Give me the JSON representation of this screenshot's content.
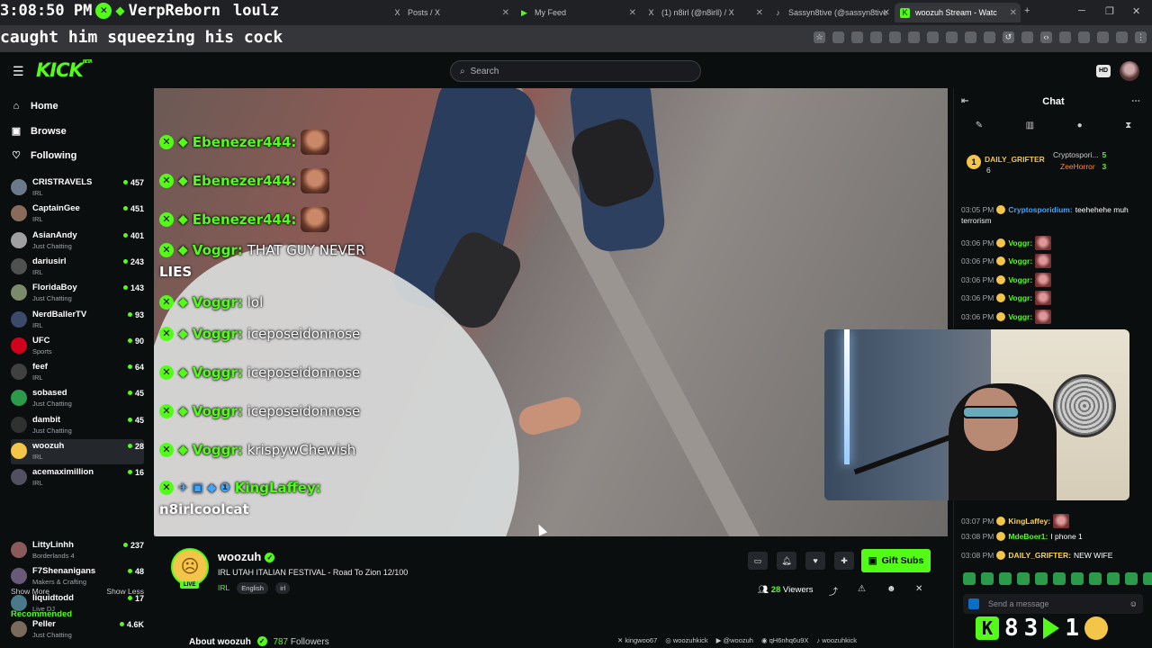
{
  "overlay_top": {
    "clock": "3:08:50 PM",
    "ticker_name": "VerpReborn",
    "ticker_extra": "loulz",
    "caption": "caught him squeezing his cock"
  },
  "browser": {
    "tabs": [
      {
        "label": "Posts / X",
        "icon": "X"
      },
      {
        "label": "My Feed",
        "icon": "▶"
      },
      {
        "label": "(1) n8irl (@n8irll) / X",
        "icon": "X"
      },
      {
        "label": "Sassyn8tive (@sassyn8tive",
        "icon": "♪"
      },
      {
        "label": "woozuh Stream - Watc",
        "icon": "K"
      }
    ],
    "new_tab": "+",
    "window_controls": [
      "─",
      "❐",
      "✕"
    ]
  },
  "header": {
    "logo": "KICK",
    "logo_sup": "BETA",
    "search_placeholder": "Search"
  },
  "sidebar": {
    "nav": [
      {
        "label": "Home",
        "icon": "⌂"
      },
      {
        "label": "Browse",
        "icon": "▣"
      },
      {
        "label": "Following",
        "icon": "♡"
      }
    ],
    "following": [
      {
        "name": "CRISTRAVELS",
        "category": "IRL",
        "viewers": "457",
        "color": "#6a7a8a"
      },
      {
        "name": "CaptainGee",
        "category": "IRL",
        "viewers": "451",
        "color": "#8a6a5a"
      },
      {
        "name": "AsianAndy",
        "category": "Just Chatting",
        "viewers": "401",
        "color": "#a0a0a0"
      },
      {
        "name": "dariusirl",
        "category": "IRL",
        "viewers": "243",
        "color": "#505050"
      },
      {
        "name": "FloridaBoy",
        "category": "Just Chatting",
        "viewers": "143",
        "color": "#7a8a6a"
      },
      {
        "name": "NerdBallerTV",
        "category": "IRL",
        "viewers": "93",
        "color": "#3a4a6a"
      },
      {
        "name": "UFC",
        "category": "Sports",
        "viewers": "90",
        "color": "#d0021b"
      },
      {
        "name": "feef",
        "category": "IRL",
        "viewers": "64",
        "color": "#404040"
      },
      {
        "name": "sobased",
        "category": "Just Chatting",
        "viewers": "45",
        "color": "#2b9a4a"
      },
      {
        "name": "dambit",
        "category": "Just Chatting",
        "viewers": "45",
        "color": "#303030"
      },
      {
        "name": "woozuh",
        "category": "IRL",
        "viewers": "28",
        "color": "#f3c64a"
      },
      {
        "name": "acemaximillion",
        "category": "IRL",
        "viewers": "16",
        "color": "#505060"
      }
    ],
    "show_more": "Show More",
    "show_less": "Show Less",
    "recommended_title": "Recommended",
    "recommended": [
      {
        "name": "LittyLinhh",
        "category": "Borderlands 4",
        "viewers": "237",
        "color": "#8a5a5a"
      },
      {
        "name": "F7Shenanigans",
        "category": "Makers & Crafting",
        "viewers": "48",
        "color": "#6a5a7a"
      },
      {
        "name": "liquidtodd",
        "category": "Live DJ",
        "viewers": "17",
        "color": "#4a7a8a"
      },
      {
        "name": "Peller",
        "category": "Just Chatting",
        "viewers": "4.6K",
        "color": "#7a6a5a"
      }
    ]
  },
  "video_overlay_chat": [
    {
      "user": "Ebenezer444:",
      "msg": "",
      "emote": true
    },
    {
      "user": "Ebenezer444:",
      "msg": "",
      "emote": true
    },
    {
      "user": "Ebenezer444:",
      "msg": "",
      "emote": true
    },
    {
      "user": "Voggr:",
      "msg": "THAT GUY NEVER",
      "cont": "LIES"
    },
    {
      "user": "Voggr:",
      "msg": "lol"
    },
    {
      "user": "Voggr:",
      "msg": "iceposeidonnose"
    },
    {
      "user": "Voggr:",
      "msg": "iceposeidonnose"
    },
    {
      "user": "Voggr:",
      "msg": "iceposeidonnose"
    },
    {
      "user": "Voggr:",
      "msg": "krispywChewish"
    },
    {
      "user": "KingLaffey:",
      "msg": "",
      "cont": "n8irlcoolcat"
    }
  ],
  "stream": {
    "name": "woozuh",
    "title": "IRL UTAH ITALIAN FESTIVAL - Road To Zion 12/100",
    "category": "IRL",
    "tags": [
      "English",
      "irl"
    ],
    "live": "LIVE",
    "gift_label": "Gift Subs",
    "viewers_count": "28",
    "viewers_label": "Viewers",
    "about_label": "About woozuh",
    "followers_count": "787",
    "followers_label": "Followers",
    "socials": [
      "kingwoo67",
      "woozuhkick",
      "@woozuh",
      "qH6nhq6u9X",
      "woozuhkick"
    ]
  },
  "chat": {
    "title": "Chat",
    "pinned": {
      "top_gifter": "DAILY_GRIFTER",
      "top_gifter_count": "6",
      "rank": "1",
      "others": [
        {
          "name": "Cryptospori...",
          "count": "5"
        },
        {
          "name": "ZeeHorror",
          "count": "3"
        }
      ]
    },
    "messages": [
      {
        "time": "03:05 PM",
        "user": "Cryptosporidium:",
        "text": "teehehehe muh",
        "cont": "terrorism",
        "color": "#3ea6ff"
      },
      {
        "time": "03:06 PM",
        "user": "Voggr:",
        "text": "",
        "emote": true,
        "color": "#53fc18"
      },
      {
        "time": "03:06 PM",
        "user": "Voggr:",
        "text": "",
        "emote": true,
        "color": "#53fc18"
      },
      {
        "time": "03:06 PM",
        "user": "Voggr:",
        "text": "",
        "emote": true,
        "color": "#53fc18"
      },
      {
        "time": "03:06 PM",
        "user": "Voggr:",
        "text": "",
        "emote": true,
        "color": "#53fc18"
      },
      {
        "time": "03:06 PM",
        "user": "Voggr:",
        "text": "",
        "emote": true,
        "color": "#53fc18"
      },
      {
        "time": "03:07 PM",
        "user": "KingLaffey:",
        "text": "",
        "emote": true,
        "color": "#ffd54a"
      },
      {
        "time": "03:08 PM",
        "user": "MdeBoer1:",
        "text": "I phone 1",
        "color": "#53fc18"
      },
      {
        "time": "03:08 PM",
        "user": "DAILY_GRIFTER:",
        "text": "NEW WIFE",
        "color": "#ffd54a"
      }
    ],
    "send_placeholder": "Send a message",
    "bottom_stats": [
      "8",
      "3",
      "1"
    ]
  },
  "colors": {
    "brand": "#53fc18",
    "bg": "#0b0e0f",
    "panel": "#191b1f"
  }
}
